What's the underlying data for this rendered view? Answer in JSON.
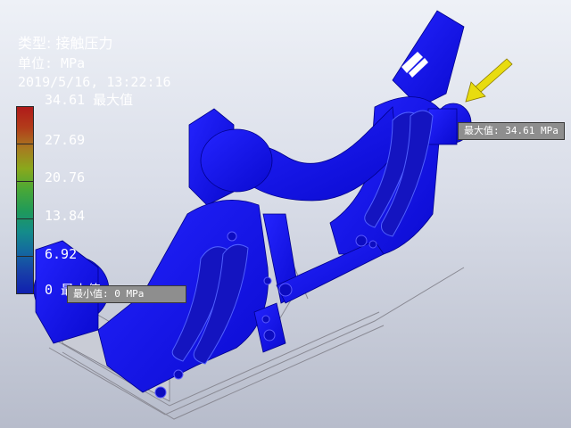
{
  "result_header": {
    "type_line": "类型: 接触压力",
    "unit_line": "单位: MPa",
    "timestamp": "2019/5/16, 13:22:16"
  },
  "legend": {
    "max_label": "34.61 最大值",
    "ticks": [
      "27.69",
      "20.76",
      "13.84",
      "6.92"
    ],
    "min_label": "0 最小值",
    "colors": [
      "#b01a1a",
      "#b23c1a",
      "#a87a20",
      "#8aa81c",
      "#4aa836",
      "#1f9a5a",
      "#148c8a",
      "#1468a0",
      "#183ea8",
      "#1020b0"
    ]
  },
  "probes": {
    "max_probe": "最大值: 34.61 MPa",
    "min_probe": "最小值: 0 MPa"
  },
  "icons": {
    "max_arrow": "yellow-arrow-icon"
  },
  "colors": {
    "part": "#1010e6",
    "background_top": "#eef1f7",
    "background_bottom": "#b7bccb",
    "arrow": "#e8dc10"
  }
}
